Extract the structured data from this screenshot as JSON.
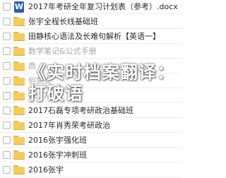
{
  "files": [
    {
      "type": "doc",
      "name": "2017年考研全年复习计划表（参考）.docx",
      "faded": false
    },
    {
      "type": "folder",
      "name": "张宇全程长线基础班",
      "faded": false
    },
    {
      "type": "folder",
      "name": "田静核心语法及长难句解析【英语一】",
      "faded": false
    },
    {
      "type": "folder",
      "name": "数学笔记&公式手册",
      "faded": true
    },
    {
      "type": "folder",
      "name": "商",
      "faded": true
    },
    {
      "type": "folder",
      "name": "何凯文",
      "faded": true
    },
    {
      "type": "folder",
      "name": "2017",
      "faded": true
    },
    {
      "type": "folder",
      "name": "2017石磊专项考研政治基础班",
      "faded": false
    },
    {
      "type": "folder",
      "name": "2017年肖秀荣考研政治",
      "faded": false
    },
    {
      "type": "folder",
      "name": "2016张宇强化班",
      "faded": false
    },
    {
      "type": "folder",
      "name": "2016张宇冲刺班",
      "faded": false
    },
    {
      "type": "folder",
      "name": "2016张宇",
      "faded": false
    }
  ],
  "doc_icon_letter": "W",
  "watermark": "《实时档案翻译：打破语",
  "colors": {
    "folder": "#f3cc5c",
    "doc_icon": "#2b5fb8",
    "faded_text": "#a5a5a5"
  }
}
